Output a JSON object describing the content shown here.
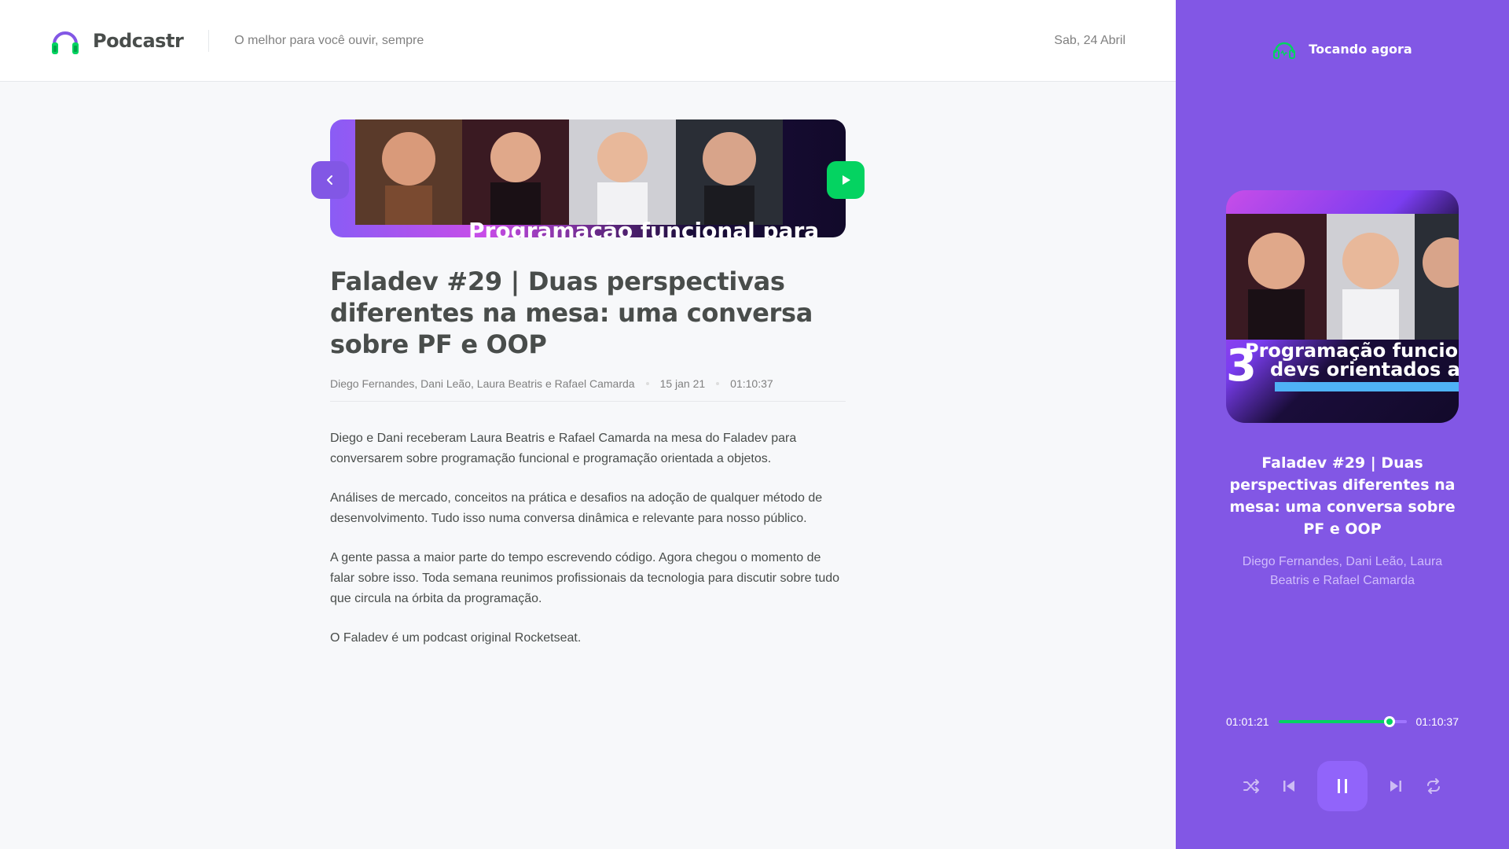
{
  "header": {
    "app_name": "Podcastr",
    "tagline": "O melhor para você ouvir, sempre",
    "date": "Sab, 24 Abril"
  },
  "episode": {
    "banner_text": "Programação funcional para",
    "title": "Faladev #29 | Duas perspectivas diferentes na mesa: uma conversa sobre PF e OOP",
    "members": "Diego Fernandes, Dani Leão, Laura Beatris e Rafael Camarda",
    "published_at": "15 jan 21",
    "duration": "01:10:37",
    "description": [
      "Diego e Dani receberam Laura Beatris e Rafael Camarda na mesa do Faladev para conversarem sobre programação funcional e programação orientada a objetos.",
      "Análises de mercado, conceitos na prática e desafios na adoção de qualquer método de desenvolvimento. Tudo isso numa conversa dinâmica e relevante para nosso público.",
      "A gente passa a maior parte do tempo escrevendo código. Agora chegou o momento de falar sobre isso. Toda semana reunimos profissionais da tecnologia para discutir sobre tudo que circula na órbita da programação.",
      "O Faladev é um podcast original Rocketseat."
    ]
  },
  "player": {
    "header_label": "Tocando agora",
    "thumb_text_line1": "Programação funcion",
    "thumb_text_line2": "devs orientados a o",
    "title": "Faladev #29 | Duas perspectivas diferentes na mesa: uma conversa sobre PF e OOP",
    "members": "Diego Fernandes, Dani Leão, Laura Beatris e Rafael Camarda",
    "current_time": "01:01:21",
    "total_time": "01:10:37",
    "progress_fraction": 0.87
  },
  "colors": {
    "purple": "#8257e5",
    "green": "#04d361",
    "text": "#494d4b",
    "muted": "#808080"
  }
}
